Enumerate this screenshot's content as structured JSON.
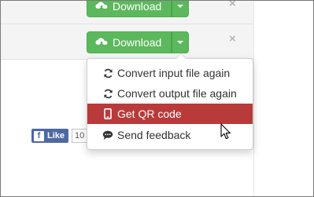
{
  "rows": [
    {
      "download_label": "Download",
      "close_label": "×"
    },
    {
      "download_label": "Download",
      "close_label": "×"
    }
  ],
  "dropdown": {
    "items": [
      {
        "label": "Convert input file again",
        "icon": "refresh-icon",
        "active": false
      },
      {
        "label": "Convert output file again",
        "icon": "refresh-icon",
        "active": false
      },
      {
        "label": "Get QR code",
        "icon": "mobile-phone-icon",
        "active": true
      },
      {
        "label": "Send feedback",
        "icon": "comment-icon",
        "active": false
      }
    ]
  },
  "social": {
    "like_label": "Like",
    "like_count": "10"
  },
  "colors": {
    "download_green": "#5cb85c",
    "active_item": "#b83a3a",
    "facebook_blue": "#4e69a2"
  }
}
